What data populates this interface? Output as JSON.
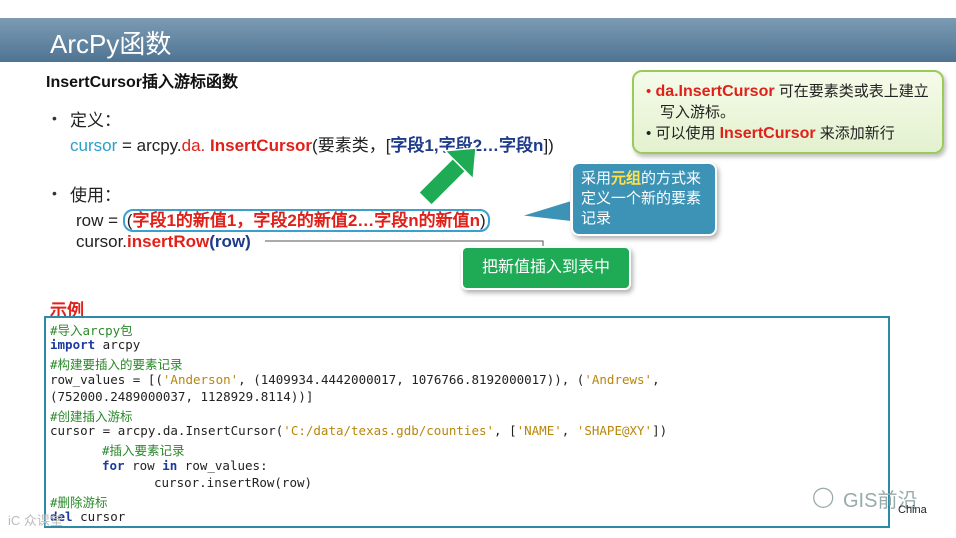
{
  "header": {
    "title": "ArcPy函数"
  },
  "subtitle": "InsertCursor插入游标函数",
  "definition": {
    "bullet": "•",
    "label": "定义：",
    "cursor_var": "cursor",
    "eq": " = arcpy.",
    "da": "da.",
    "func": " InsertCursor",
    "args_prefix": "(要素类，[",
    "fields": "字段1,字段2…字段n",
    "args_suffix": "])"
  },
  "usage": {
    "bullet": "•",
    "label": "使用：",
    "row_prefix": "row = ",
    "tuple_open": "(",
    "tuple_values": "字段1的新值1，字段2的新值2…字段n的新值n",
    "tuple_close": ")",
    "cursor_prefix": "cursor.",
    "insert_row": "insertRow",
    "insert_arg": "(row)"
  },
  "note": {
    "items": [
      {
        "bullet": "•",
        "highlight": "da.InsertCursor",
        "text": " 可在要素类或表上建立写入游标。"
      },
      {
        "bullet": "•",
        "prefix": "可以使用 ",
        "highlight": "InsertCursor",
        "text": " 来添加新行"
      }
    ]
  },
  "callout": {
    "pre": "采用",
    "highlight": "元组",
    "post": "的方式来定义一个新的要素记录"
  },
  "green_button": "把新值插入到表中",
  "example_label": "示例",
  "code": [
    {
      "cls": "cm",
      "text": "#导入arcpy包"
    },
    {
      "cls": "mix1",
      "kw": "import",
      "text": " arcpy"
    },
    {
      "cls": "cm",
      "text": "#构建要插入的要素记录"
    },
    {
      "cls": "plain",
      "text": "row_values = [('Anderson', (1409934.4442000017, 1076766.8192000017)), ('Andrews',"
    },
    {
      "cls": "plain",
      "text": "(752000.2489000037, 1128929.8114))]"
    },
    {
      "cls": "cm",
      "text": "#创建插入游标"
    },
    {
      "cls": "plain",
      "text": "cursor = arcpy.da.InsertCursor('C:/data/texas.gdb/counties', ['NAME', 'SHAPE@XY'])"
    },
    {
      "cls": "cm",
      "indent": 1,
      "text": "#插入要素记录"
    },
    {
      "cls": "for",
      "indent": 1,
      "text": "for row in row_values:"
    },
    {
      "cls": "plain",
      "indent": 2,
      "text": "cursor.insertRow(row)"
    },
    {
      "cls": "cm",
      "text": "#删除游标"
    },
    {
      "cls": "mix1",
      "kw": "del",
      "text": " cursor"
    }
  ],
  "watermark": {
    "right": "GIS前沿",
    "right_small": "China",
    "left": "iC 众课堂"
  }
}
